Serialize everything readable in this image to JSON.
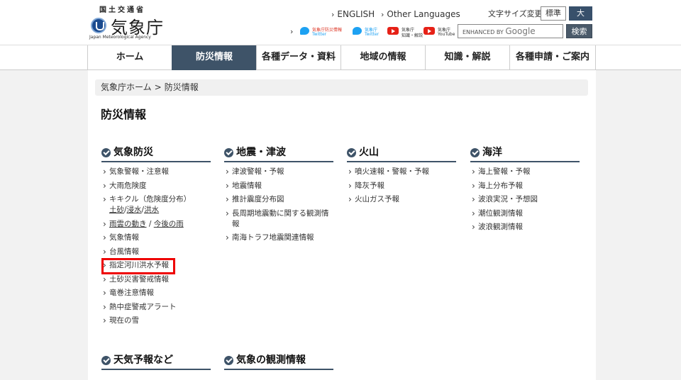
{
  "header": {
    "ministry": "国土交通省",
    "agency_name": "気象庁",
    "agency_en": "Japan Meteorological Agency",
    "english_link": "ENGLISH",
    "other_languages_link": "Other Languages",
    "font_size_label": "文字サイズ変更",
    "font_standard": "標準",
    "font_large": "大",
    "sns": [
      {
        "icon": "twitter-icon",
        "line1": "気象庁防災情報",
        "line2": "Twitter"
      },
      {
        "icon": "twitter-icon",
        "line1": "気象庁",
        "line2": "Twitter"
      },
      {
        "icon": "youtube-icon",
        "line1": "気象庁",
        "line2": "知識・解説"
      },
      {
        "icon": "youtube-icon",
        "line1": "気象庁",
        "line2": "YouTube"
      }
    ],
    "search_placeholder_prefix": "ENHANCED BY",
    "search_placeholder_brand": "Google",
    "search_button": "検索"
  },
  "nav": [
    "ホーム",
    "防災情報",
    "各種データ・資料",
    "地域の情報",
    "知識・解説",
    "各種申請・ご案内"
  ],
  "breadcrumb": {
    "home": "気象庁ホーム",
    "sep": ">",
    "current": "防災情報"
  },
  "page_title": "防災情報",
  "columns": [
    {
      "title": "気象防災",
      "items": [
        "気象警報・注意報",
        "大雨危険度",
        "キキクル（危険度分布）",
        "雨雲の動き",
        "気象情報",
        "台風情報",
        "指定河川洪水予報",
        "土砂災害警戒情報",
        "竜巻注意情報",
        "熱中症警戒アラート",
        "現在の雪"
      ],
      "kikikuru_sub": [
        "土砂",
        "浸水",
        "洪水"
      ],
      "amagumo_sub": "今後の雨"
    },
    {
      "title": "地震・津波",
      "items": [
        "津波警報・予報",
        "地震情報",
        "推計震度分布図",
        "長周期地震動に関する観測情報",
        "南海トラフ地震関連情報"
      ]
    },
    {
      "title": "火山",
      "items": [
        "噴火速報・警報・予報",
        "降灰予報",
        "火山ガス予報"
      ]
    },
    {
      "title": "海洋",
      "items": [
        "海上警報・予報",
        "海上分布予報",
        "波浪実況・予想図",
        "潮位観測情報",
        "波浪観測情報"
      ]
    },
    {
      "title": "天気予報など",
      "items": []
    },
    {
      "title": "気象の観測情報",
      "items": []
    }
  ],
  "colors": {
    "nav_active": "#3e5368",
    "highlight": "#ee0000",
    "twitter": "#1da1f2",
    "youtube": "#e62117"
  }
}
